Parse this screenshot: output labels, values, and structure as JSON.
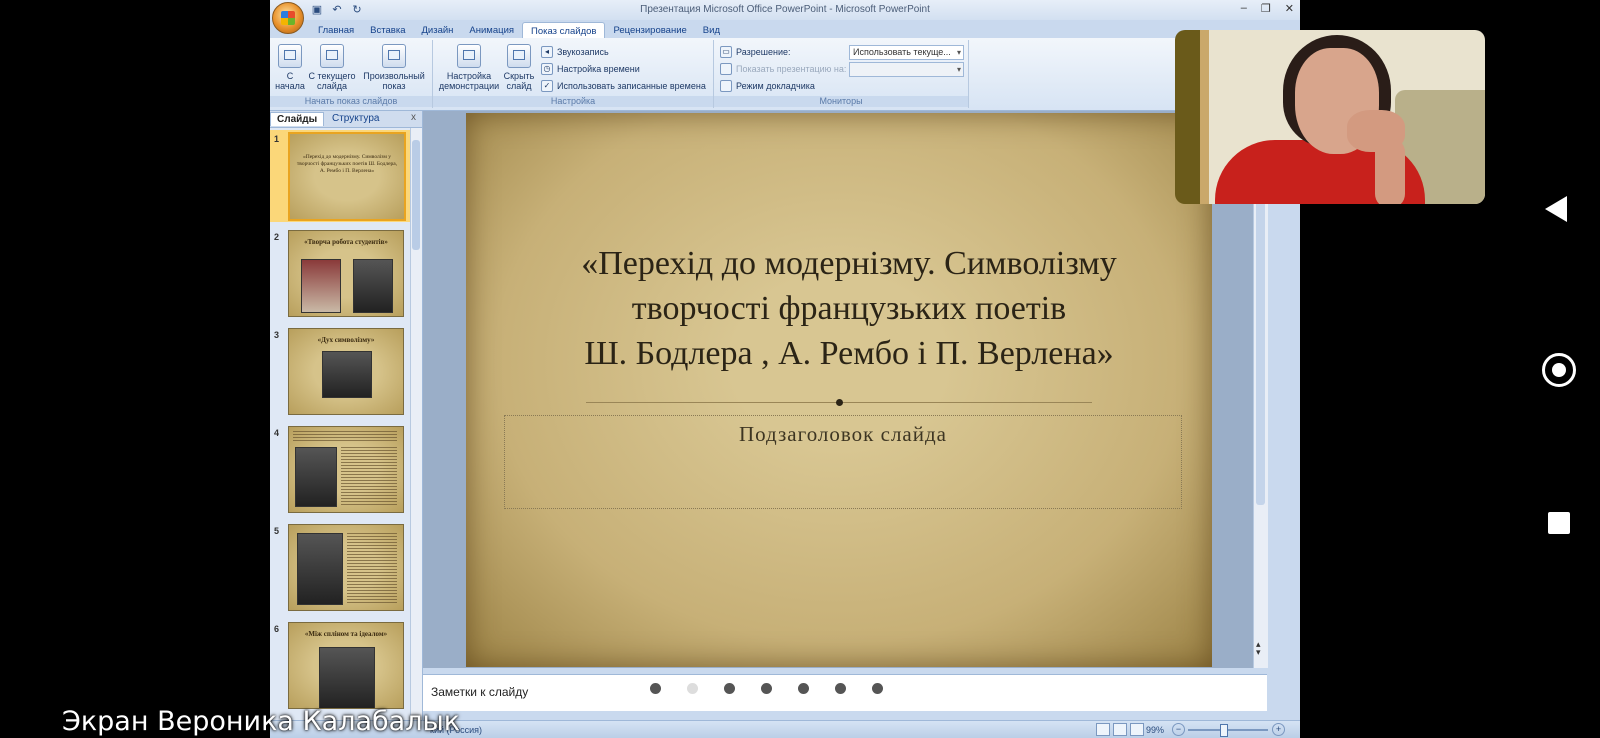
{
  "window": {
    "title": "Презентация Microsoft Office PowerPoint - Microsoft PowerPoint"
  },
  "quick_access": [
    "save-icon",
    "undo-icon",
    "redo-icon"
  ],
  "ribbon": {
    "tabs": [
      "Главная",
      "Вставка",
      "Дизайн",
      "Анимация",
      "Показ слайдов",
      "Рецензирование",
      "Вид"
    ],
    "active_tab": "Показ слайдов",
    "groups": {
      "start": {
        "label": "Начать показ слайдов",
        "btn_from_start": "С начала",
        "btn_from_current": "С текущего слайда",
        "btn_custom": "Произвольный показ"
      },
      "setup": {
        "label": "Настройка",
        "btn_setup": "Настройка демонстрации",
        "btn_hide": "Скрыть слайд",
        "record": "Звукозапись",
        "timings": "Настройка времени",
        "use_timings": "Использовать записанные времена"
      },
      "monitors": {
        "label": "Мониторы",
        "resolution_label": "Разрешение:",
        "resolution_value": "Использовать текуще...",
        "show_on": "Показать презентацию на:",
        "presenter_view": "Режим докладчика"
      }
    }
  },
  "panel": {
    "tabs": [
      "Слайды",
      "Структура"
    ],
    "close": "x",
    "thumbnails": [
      {
        "num": "1",
        "text": "«Перехід до модернізму. Символізм у творчості французьких поетів Ш. Бодлера, А. Рембо і П. Верлена»"
      },
      {
        "num": "2",
        "text": "«Творча робота студентів»"
      },
      {
        "num": "3",
        "text": "«Дух символізму»"
      },
      {
        "num": "4",
        "text": ""
      },
      {
        "num": "5",
        "text": ""
      },
      {
        "num": "6",
        "text": "«Між спліном та ідеалом»"
      }
    ]
  },
  "slide": {
    "title_line1": "«Перехід до модернізму. Символізму",
    "title_line2": "творчості французьких поетів",
    "title_line3": "Ш. Бодлера , А. Рембо і П. Верлена»",
    "subtitle": "Подзаголовок слайда"
  },
  "notes": {
    "placeholder": "Заметки к слайду"
  },
  "status": {
    "language": "кий (Россия)",
    "zoom": "99%"
  },
  "caption": "Экран Вероника Калабалык",
  "colors": {
    "ribbon": "#d7e4f4",
    "slide_paper": "#c7b077",
    "webcam_shirt": "#c8211c"
  }
}
